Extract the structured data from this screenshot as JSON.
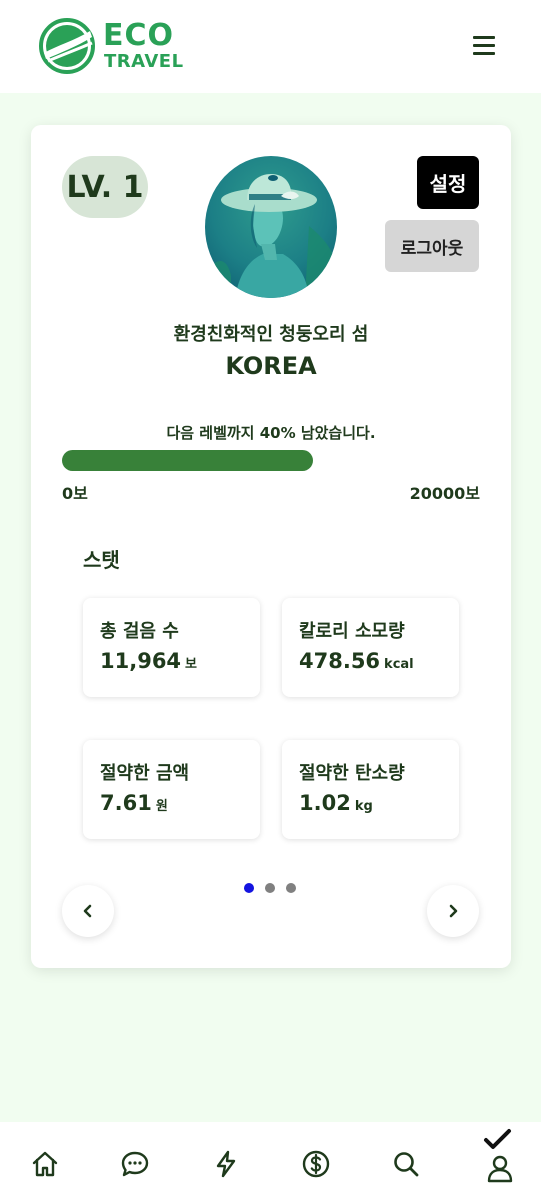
{
  "header": {
    "logo_line1": "ECO",
    "logo_line2": "TRAVEL",
    "menu_icon": "hamburger-menu-icon"
  },
  "profile": {
    "level": "LV. 1",
    "settings_label": "설정",
    "logout_label": "로그아웃",
    "name": "환경친화적인 청둥오리 섬",
    "country": "KOREA"
  },
  "progress": {
    "text": "다음 레벨까지 40% 남았습니다.",
    "fraction": 0.6,
    "min_label": "0보",
    "max_label": "20000보"
  },
  "stats": {
    "title": "스탯",
    "items": [
      {
        "label": "총 걸음 수",
        "value": "11,964",
        "unit": "보"
      },
      {
        "label": "칼로리 소모량",
        "value": "478.56",
        "unit": "kcal"
      },
      {
        "label": "절약한 금액",
        "value": "7.61",
        "unit": "원"
      },
      {
        "label": "절약한 탄소량",
        "value": "1.02",
        "unit": "kg"
      }
    ]
  },
  "pagination": {
    "count": 3,
    "active_index": 0
  },
  "bottom_nav": [
    {
      "icon": "home-icon"
    },
    {
      "icon": "chat-icon"
    },
    {
      "icon": "lightning-icon"
    },
    {
      "icon": "dollar-icon"
    },
    {
      "icon": "search-icon"
    },
    {
      "icon": "profile-check-icon"
    }
  ],
  "colors": {
    "brand_green": "#2aa157",
    "progress_green": "#388139",
    "background": "#f1fdf0",
    "text_dark": "#1f3a1c",
    "dot_active": "#1414e0",
    "dot_inactive": "#808080"
  }
}
